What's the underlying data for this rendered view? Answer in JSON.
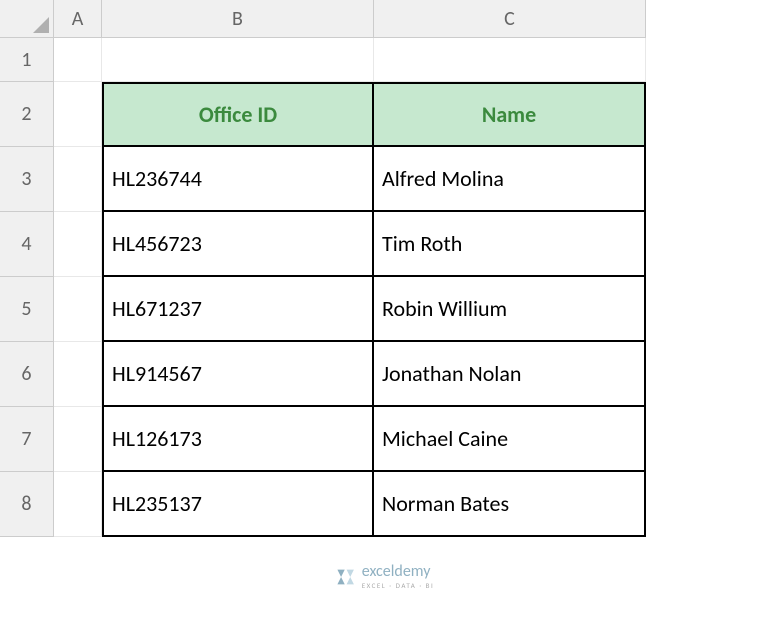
{
  "columns": [
    "A",
    "B",
    "C"
  ],
  "rows": [
    "1",
    "2",
    "3",
    "4",
    "5",
    "6",
    "7",
    "8"
  ],
  "table": {
    "headers": {
      "b": "Office ID",
      "c": "Name"
    },
    "data": [
      {
        "id": "HL236744",
        "name": "Alfred Molina"
      },
      {
        "id": "HL456723",
        "name": "Tim Roth"
      },
      {
        "id": "HL671237",
        "name": "Robin Willium"
      },
      {
        "id": "HL914567",
        "name": "Jonathan Nolan"
      },
      {
        "id": "HL126173",
        "name": "Michael Caine"
      },
      {
        "id": "HL235137",
        "name": "Norman Bates"
      }
    ]
  },
  "watermark": {
    "brand": "exceldemy",
    "tag": "EXCEL · DATA · BI"
  }
}
